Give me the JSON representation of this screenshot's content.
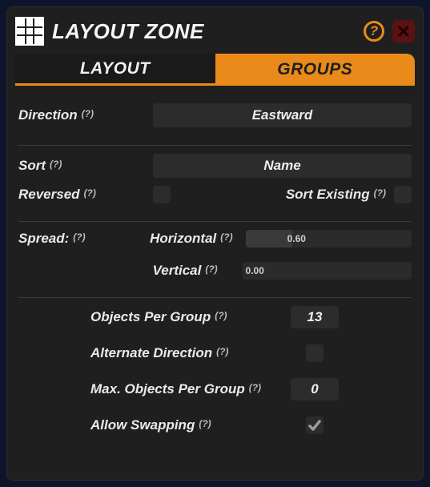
{
  "header": {
    "title": "LAYOUT ZONE",
    "help_symbol": "?",
    "close_symbol": "X"
  },
  "tabs": {
    "layout": "LAYOUT",
    "groups": "GROUPS",
    "active": "groups"
  },
  "direction": {
    "label": "Direction",
    "hint": "(?)",
    "value": "Eastward"
  },
  "sort": {
    "label": "Sort",
    "hint": "(?)",
    "value": "Name",
    "reversed_label": "Reversed",
    "reversed_hint": "(?)",
    "reversed": false,
    "sort_existing_label": "Sort Existing",
    "sort_existing_hint": "(?)",
    "sort_existing": false
  },
  "spread": {
    "label": "Spread:",
    "hint": "(?)",
    "horizontal_label": "Horizontal",
    "horizontal_hint": "(?)",
    "horizontal_value": "0.60",
    "vertical_label": "Vertical",
    "vertical_hint": "(?)",
    "vertical_value": "0.00"
  },
  "options": {
    "objects_per_group_label": "Objects Per Group",
    "objects_per_group_hint": "(?)",
    "objects_per_group_value": "13",
    "alternate_direction_label": "Alternate Direction",
    "alternate_direction_hint": "(?)",
    "alternate_direction_value": false,
    "max_objects_label": "Max. Objects Per Group",
    "max_objects_hint": "(?)",
    "max_objects_value": "0",
    "allow_swapping_label": "Allow Swapping",
    "allow_swapping_hint": "(?)",
    "allow_swapping_value": true
  }
}
